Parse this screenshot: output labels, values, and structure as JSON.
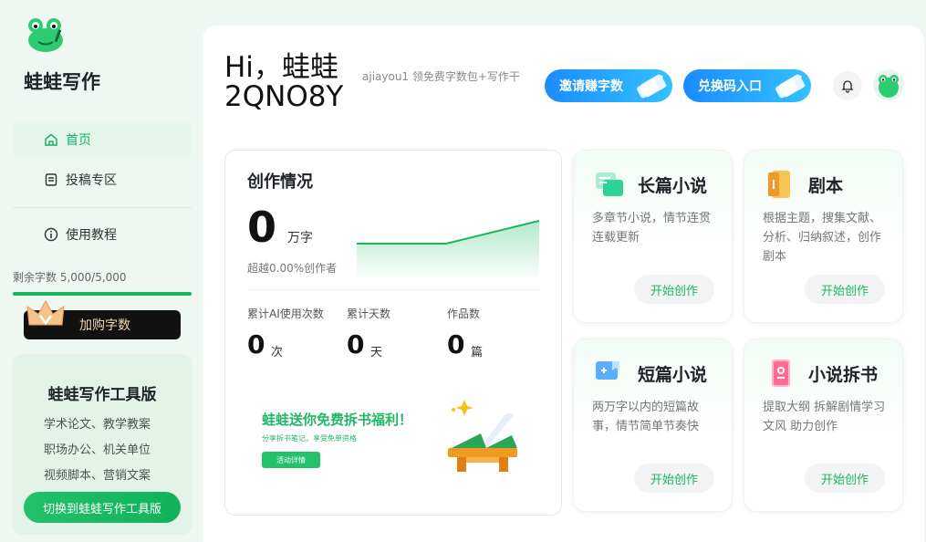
{
  "sidebar": {
    "brand": "蛙蛙写作",
    "nav": [
      {
        "label": "首页",
        "icon": "home-icon"
      },
      {
        "label": "投稿专区",
        "icon": "submit-icon"
      },
      {
        "label": "使用教程",
        "icon": "info-icon"
      }
    ],
    "quota_text": "剩余字数 5,000/5,000",
    "quota_fraction": 1.0,
    "buy_label": "加购字数",
    "tool_card": {
      "title": "蛙蛙写作工具版",
      "lines": [
        "学术论文、教学教案",
        "职场办公、机关单位",
        "视频脚本、营销文案"
      ],
      "button": "切换到蛙蛙写作工具版"
    }
  },
  "header": {
    "greeting": "Hi，蛙蛙\n2QNO8Y",
    "ticker": "ajiayou1 领免费字数包+写作干",
    "invite_label": "邀请赚字数",
    "redeem_label": "兑换码入口"
  },
  "stats": {
    "title": "创作情况",
    "words": "0",
    "words_unit": "万字",
    "beat_text": "超越0.00%创作者",
    "metrics": [
      {
        "label": "累计AI使用次数",
        "value": "0",
        "unit": "次"
      },
      {
        "label": "累计天数",
        "value": "0",
        "unit": "天"
      },
      {
        "label": "作品数",
        "value": "0",
        "unit": "篇"
      }
    ],
    "promo": {
      "title": "蛙蛙送你免费拆书福利！",
      "sub": "分享拆书笔记，享受免单资格",
      "button": "活动详情"
    }
  },
  "features": [
    {
      "title": "长篇小说",
      "desc": "多章节小说，情节连贯连载更新",
      "button": "开始创作",
      "icon": "long-novel-icon"
    },
    {
      "title": "剧本",
      "desc": "根据主题，搜集文献、分析、归纳叙述，创作剧本",
      "button": "开始创作",
      "icon": "script-icon"
    },
    {
      "title": "短篇小说",
      "desc": "两万字以内的短篇故事，情节简单节奏快",
      "button": "开始创作",
      "icon": "short-novel-icon"
    },
    {
      "title": "小说拆书",
      "desc": "提取大纲 拆解剧情学习文风 助力创作",
      "button": "开始创作",
      "icon": "book-breakdown-icon"
    }
  ],
  "colors": {
    "brand_green": "#18b65e",
    "accent_blue": "#1a8cff"
  }
}
